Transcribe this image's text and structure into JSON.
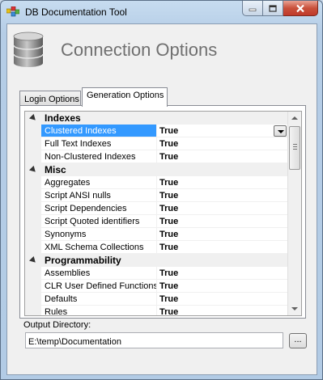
{
  "window": {
    "title": "DB Documentation Tool"
  },
  "header": {
    "title": "Connection Options"
  },
  "tabs": [
    {
      "label": "Login Options"
    },
    {
      "label": "Generation Options",
      "selected": true
    }
  ],
  "grid": {
    "rows": [
      {
        "type": "category",
        "label": "Indexes"
      },
      {
        "type": "property",
        "name": "Clustered Indexes",
        "value": "True",
        "selected": true
      },
      {
        "type": "property",
        "name": "Full Text Indexes",
        "value": "True"
      },
      {
        "type": "property",
        "name": "Non-Clustered Indexes",
        "value": "True"
      },
      {
        "type": "category",
        "label": "Misc"
      },
      {
        "type": "property",
        "name": "Aggregates",
        "value": "True"
      },
      {
        "type": "property",
        "name": "Script ANSI nulls",
        "value": "True"
      },
      {
        "type": "property",
        "name": "Script Dependencies",
        "value": "True"
      },
      {
        "type": "property",
        "name": "Script Quoted identifiers",
        "value": "True"
      },
      {
        "type": "property",
        "name": "Synonyms",
        "value": "True"
      },
      {
        "type": "property",
        "name": "XML Schema Collections",
        "value": "True"
      },
      {
        "type": "category",
        "label": "Programmability"
      },
      {
        "type": "property",
        "name": "Assemblies",
        "value": "True"
      },
      {
        "type": "property",
        "name": "CLR User Defined Functions",
        "value": "True"
      },
      {
        "type": "property",
        "name": "Defaults",
        "value": "True"
      },
      {
        "type": "property",
        "name": "Rules",
        "value": "True"
      }
    ]
  },
  "output": {
    "label": "Output Directory:",
    "value": "E:\\temp\\Documentation",
    "browse_label": "..."
  },
  "colors": {
    "selection": "#3399ff",
    "close_button": "#c9513b"
  },
  "icons": [
    "app-icon",
    "database-icon",
    "minimize-icon",
    "maximize-icon",
    "close-icon",
    "expander-icon",
    "dropdown-arrow-icon"
  ]
}
